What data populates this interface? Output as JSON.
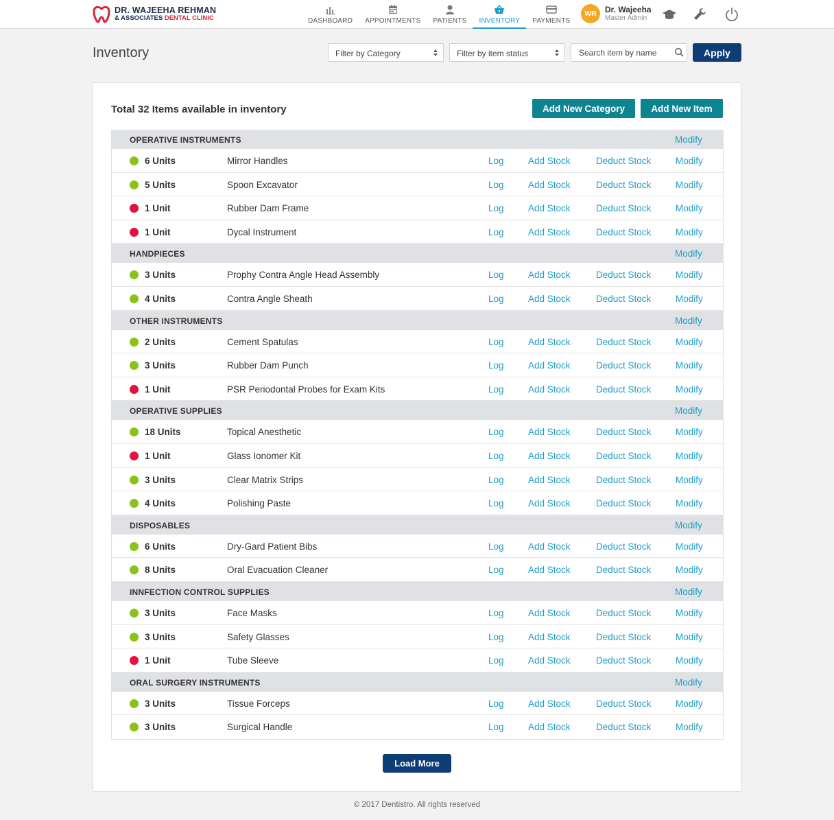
{
  "brand": {
    "line1": "DR. WAJEEHA REHMAN",
    "line2_prefix": "& ASSOCIATES ",
    "line2_highlight": "DENTAL CLINIC",
    "accent_red": "#d6283b",
    "navy": "#1c2b4f"
  },
  "nav": [
    {
      "label": "DASHBOARD",
      "icon": "bar-chart-icon",
      "active": false
    },
    {
      "label": "APPOINTMENTS",
      "icon": "calendar-icon",
      "active": false
    },
    {
      "label": "PATIENTS",
      "icon": "person-icon",
      "active": false
    },
    {
      "label": "INVENTORY",
      "icon": "basket-icon",
      "active": true
    },
    {
      "label": "PAYMENTS",
      "icon": "credit-card-icon",
      "active": false
    }
  ],
  "user": {
    "initials": "WR",
    "name": "Dr. Wajeeha",
    "role": "Master Admin"
  },
  "header_icons": [
    "graduation-cap-icon",
    "wrench-icon",
    "power-icon"
  ],
  "page": {
    "title": "Inventory",
    "filter_category": "Filter by Category",
    "filter_status": "Filter by item status",
    "search_placeholder": "Search item by name",
    "apply_label": "Apply"
  },
  "card": {
    "total_text": "Total 32 Items available in inventory",
    "add_category_label": "Add New Category",
    "add_item_label": "Add New Item",
    "load_more_label": "Load More"
  },
  "actions": {
    "log": "Log",
    "add": "Add Stock",
    "deduct": "Deduct Stock",
    "modify": "Modify"
  },
  "status_colors": {
    "ok": "#8bc21a",
    "low": "#e2123d",
    "link": "#1d9dc8"
  },
  "categories": [
    {
      "name": "OPERATIVE INSTRUMENTS",
      "items": [
        {
          "units": "6 Units",
          "name": "Mirror Handles",
          "status": "ok"
        },
        {
          "units": "5 Units",
          "name": "Spoon Excavator",
          "status": "ok"
        },
        {
          "units": "1 Unit",
          "name": "Rubber Dam Frame",
          "status": "low"
        },
        {
          "units": "1 Unit",
          "name": "Dycal Instrument",
          "status": "low"
        }
      ]
    },
    {
      "name": "HANDPIECES",
      "items": [
        {
          "units": "3 Units",
          "name": "Prophy Contra Angle Head Assembly",
          "status": "ok"
        },
        {
          "units": "4 Units",
          "name": "Contra Angle Sheath",
          "status": "ok"
        }
      ]
    },
    {
      "name": "OTHER INSTRUMENTS",
      "items": [
        {
          "units": "2 Units",
          "name": "Cement Spatulas",
          "status": "ok"
        },
        {
          "units": "3 Units",
          "name": "Rubber Dam Punch",
          "status": "ok"
        },
        {
          "units": "1 Unit",
          "name": "PSR Periodontal Probes for Exam Kits",
          "status": "low"
        }
      ]
    },
    {
      "name": "OPERATIVE SUPPLIES",
      "items": [
        {
          "units": "18 Units",
          "name": "Topical Anesthetic",
          "status": "ok"
        },
        {
          "units": "1 Unit",
          "name": "Glass Ionomer Kit",
          "status": "low"
        },
        {
          "units": "3 Units",
          "name": "Clear Matrix Strips",
          "status": "ok"
        },
        {
          "units": "4 Units",
          "name": "Polishing Paste",
          "status": "ok"
        }
      ]
    },
    {
      "name": "DISPOSABLES",
      "items": [
        {
          "units": "6 Units",
          "name": "Dry-Gard Patient Bibs",
          "status": "ok"
        },
        {
          "units": "8 Units",
          "name": "Oral Evacuation Cleaner",
          "status": "ok"
        }
      ]
    },
    {
      "name": "INNFECTION CONTROL SUPPLIES",
      "items": [
        {
          "units": "3 Units",
          "name": "Face Masks",
          "status": "ok"
        },
        {
          "units": "3 Units",
          "name": "Safety Glasses",
          "status": "ok"
        },
        {
          "units": "1 Unit",
          "name": "Tube Sleeve",
          "status": "low"
        }
      ]
    },
    {
      "name": "ORAL SURGERY INSTRUMENTS",
      "items": [
        {
          "units": "3 Units",
          "name": "Tissue Forceps",
          "status": "ok"
        },
        {
          "units": "3 Units",
          "name": "Surgical Handle",
          "status": "ok"
        }
      ]
    }
  ],
  "footer": "© 2017 Dentistro. All rights reserved"
}
